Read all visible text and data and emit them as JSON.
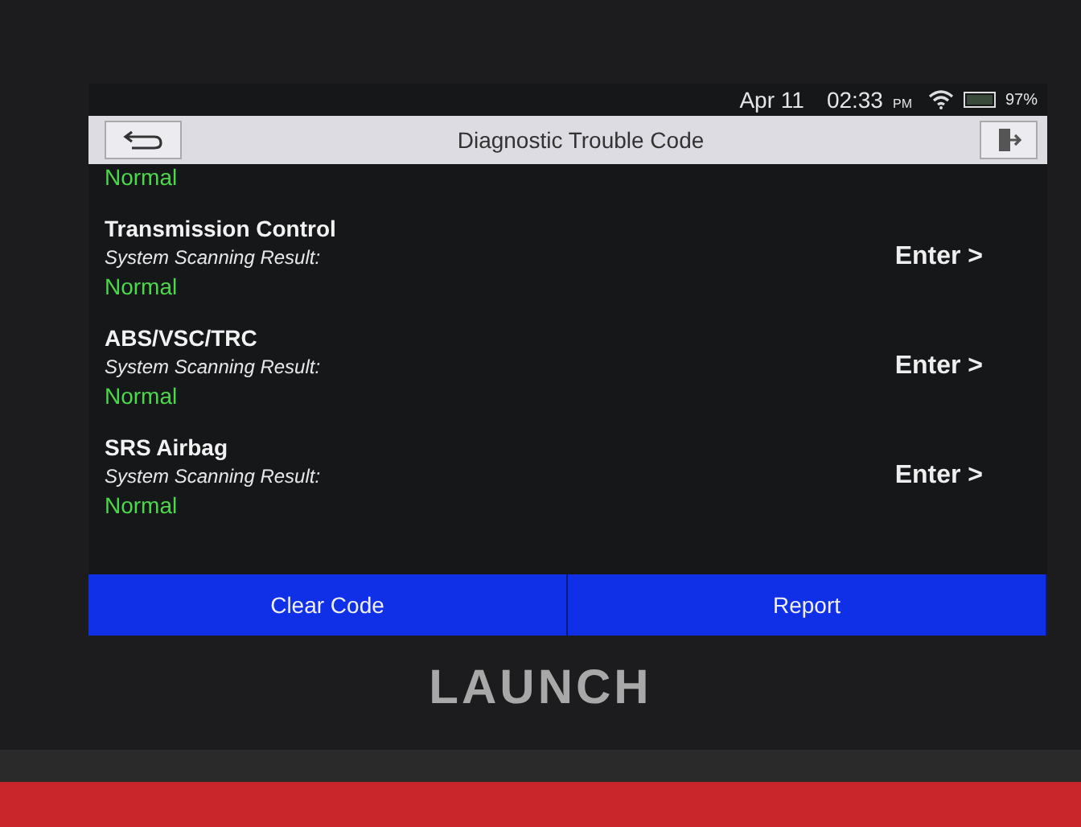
{
  "status_bar": {
    "date": "Apr 11",
    "time": "02:33",
    "ampm": "PM",
    "battery": "97%",
    "battery_meter": {
      "level": 0.97
    }
  },
  "header": {
    "title": "Diagnostic Trouble Code"
  },
  "top_partial_result": "Normal",
  "systems": [
    {
      "name": "Transmission Control",
      "label": "System Scanning Result:",
      "result": "Normal",
      "action": "Enter >"
    },
    {
      "name": "ABS/VSC/TRC",
      "label": "System Scanning Result:",
      "result": "Normal",
      "action": "Enter >"
    },
    {
      "name": "SRS Airbag",
      "label": "System Scanning Result:",
      "result": "Normal",
      "action": "Enter >"
    }
  ],
  "buttons": [
    "Clear Code",
    "Report"
  ],
  "device": {
    "brand": "LAUNCH"
  }
}
